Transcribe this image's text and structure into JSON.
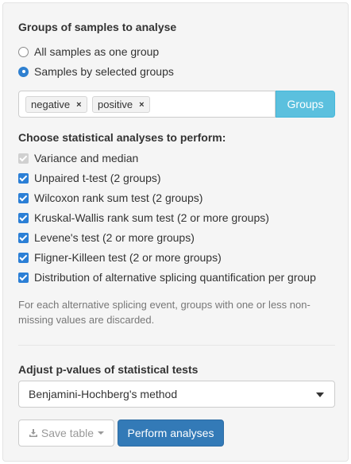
{
  "groups_section": {
    "title": "Groups of samples to analyse",
    "options": [
      {
        "label": "All samples as one group",
        "selected": false
      },
      {
        "label": "Samples by selected groups",
        "selected": true
      }
    ],
    "tags": [
      "negative",
      "positive"
    ],
    "tag_remove_glyph": "×",
    "groups_button_label": "Groups"
  },
  "analyses_section": {
    "title": "Choose statistical analyses to perform:",
    "checks": [
      {
        "label": "Variance and median",
        "checked": true,
        "disabled": true
      },
      {
        "label": "Unpaired t-test (2 groups)",
        "checked": true,
        "disabled": false
      },
      {
        "label": "Wilcoxon rank sum test (2 groups)",
        "checked": true,
        "disabled": false
      },
      {
        "label": "Kruskal-Wallis rank sum test (2 or more groups)",
        "checked": true,
        "disabled": false
      },
      {
        "label": "Levene's test (2 or more groups)",
        "checked": true,
        "disabled": false
      },
      {
        "label": "Fligner-Killeen test (2 or more groups)",
        "checked": true,
        "disabled": false
      },
      {
        "label": "Distribution of alternative splicing quantification per group",
        "checked": true,
        "disabled": false
      }
    ],
    "note": "For each alternative splicing event, groups with one or less non-missing values are discarded."
  },
  "pvalue_section": {
    "title": "Adjust p-values of statistical tests",
    "selected_method": "Benjamini-Hochberg's method"
  },
  "actions": {
    "save_label": "Save table",
    "perform_label": "Perform analyses"
  },
  "colors": {
    "primary": "#337ab7",
    "info": "#5bc0de",
    "checkbox": "#2b7fd6",
    "panel_bg": "#f5f5f5"
  },
  "icons": {
    "save": "download-icon",
    "dropdown": "caret-down-icon"
  }
}
